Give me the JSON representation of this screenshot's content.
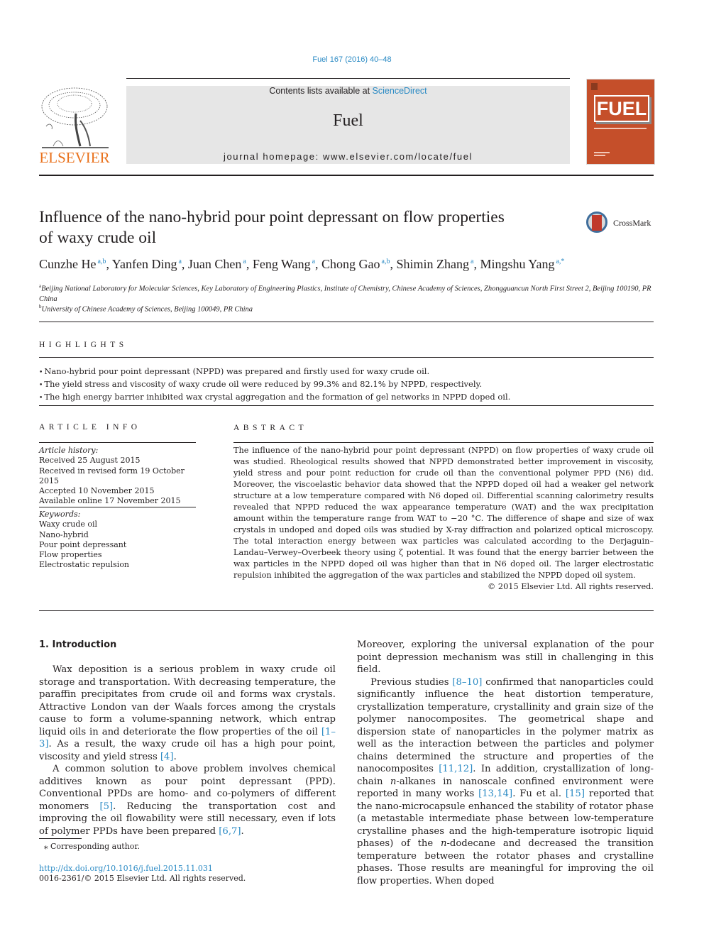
{
  "journal": {
    "citation": "Fuel 167 (2016) 40–48",
    "contents_prefix": "Contents lists available at ",
    "contents_link": "ScienceDirect",
    "name": "Fuel",
    "homepage": "journal homepage: www.elsevier.com/locate/fuel",
    "publisher_logo": "ELSEVIER",
    "cover_title": "FUEL",
    "crossmark_label": "CrossMark"
  },
  "article": {
    "title_line1": "Influence of the nano-hybrid pour point depressant on flow properties",
    "title_line2": "of waxy crude oil",
    "authors": [
      {
        "name": "Cunzhe He",
        "sup": "a,b",
        "sep": ", "
      },
      {
        "name": "Yanfen Ding",
        "sup": "a",
        "sep": ", "
      },
      {
        "name": "Juan Chen",
        "sup": "a",
        "sep": ", "
      },
      {
        "name": "Feng Wang",
        "sup": "a",
        "sep": ", "
      },
      {
        "name": "Chong Gao",
        "sup": "a,b",
        "sep": ", "
      },
      {
        "name": "Shimin Zhang",
        "sup": "a",
        "sep": ", "
      },
      {
        "name": "Mingshu Yang",
        "sup": "a,*",
        "sep": ""
      }
    ],
    "affiliations": [
      {
        "mark": "a",
        "text": "Beijing National Laboratory for Molecular Sciences, Key Laboratory of Engineering Plastics, Institute of Chemistry, Chinese Academy of Sciences, Zhongguancun North First Street 2, Beijing 100190, PR China"
      },
      {
        "mark": "b",
        "text": "University of Chinese Academy of Sciences, Beijing 100049, PR China"
      }
    ]
  },
  "highlights": {
    "heading": "HIGHLIGHTS",
    "items": [
      "Nano-hybrid pour point depressant (NPPD) was prepared and firstly used for waxy crude oil.",
      "The yield stress and viscosity of waxy crude oil were reduced by 99.3% and 82.1% by NPPD, respectively.",
      "The high energy barrier inhibited wax crystal aggregation and the formation of gel networks in NPPD doped oil."
    ]
  },
  "article_info": {
    "heading": "ARTICLE INFO",
    "history_label": "Article history:",
    "history": [
      "Received 25 August 2015",
      "Received in revised form 19 October 2015",
      "Accepted 10 November 2015",
      "Available online 17 November 2015"
    ],
    "keywords_label": "Keywords:",
    "keywords": [
      "Waxy crude oil",
      "Nano-hybrid",
      "Pour point depressant",
      "Flow properties",
      "Electrostatic repulsion"
    ]
  },
  "abstract": {
    "heading": "ABSTRACT",
    "text": "The influence of the nano-hybrid pour point depressant (NPPD) on flow properties of waxy crude oil was studied. Rheological results showed that NPPD demonstrated better improvement in viscosity, yield stress and pour point reduction for crude oil than the conventional polymer PPD (N6) did. Moreover, the viscoelastic behavior data showed that the NPPD doped oil had a weaker gel network structure at a low temperature compared with N6 doped oil. Differential scanning calorimetry results revealed that NPPD reduced the wax appearance temperature (WAT) and the wax precipitation amount within the temperature range from WAT to −20 °C. The difference of shape and size of wax crystals in undoped and doped oils was studied by X-ray diffraction and polarized optical microscopy. The total interaction energy between wax particles was calculated according to the Derjaguin–Landau–Verwey–Overbeek theory using ζ potential. It was found that the energy barrier between the wax particles in the NPPD doped oil was higher than that in N6 doped oil. The larger electrostatic repulsion inhibited the aggregation of the wax particles and stabilized the NPPD doped oil system.",
    "copyright": "© 2015 Elsevier Ltd. All rights reserved."
  },
  "introduction": {
    "heading": "1. Introduction",
    "left_p1": [
      {
        "t": "Wax deposition is a serious problem in waxy crude oil storage and transportation. With decreasing temperature, the paraffin precipitates from crude oil and forms wax crystals. Attractive London van der Waals forces among the crystals cause to form a volume-spanning network, which entrap liquid oils in and deteriorate the flow properties of the oil "
      },
      {
        "ref": "[1–3]"
      },
      {
        "t": ". As a result, the waxy crude oil has a high pour point, viscosity and yield stress "
      },
      {
        "ref": "[4]"
      },
      {
        "t": "."
      }
    ],
    "left_p2": [
      {
        "t": "A common solution to above problem involves chemical additives known as pour point depressant (PPD). Conventional PPDs are homo- and co-polymers of different monomers "
      },
      {
        "ref": "[5]"
      },
      {
        "t": ". Reducing the transportation cost and improving the oil flowability were still necessary, even if lots of polymer PPDs have been prepared "
      },
      {
        "ref": "[6,7]"
      },
      {
        "t": "."
      }
    ],
    "right_p1": [
      {
        "t": "Moreover, exploring the universal explanation of the pour point depression mechanism was still in challenging in this field."
      }
    ],
    "right_p2": [
      {
        "t": "Previous studies "
      },
      {
        "ref": "[8–10]"
      },
      {
        "t": " confirmed that nanoparticles could significantly influence the heat distortion temperature, crystallization temperature, crystallinity and grain size of the polymer nanocomposites. The geometrical shape and dispersion state of nanoparticles in the polymer matrix as well as the interaction between the particles and polymer chains determined the structure and properties of the nanocomposites "
      },
      {
        "ref": "[11,12]"
      },
      {
        "t": ". In addition, crystallization of long-chain "
      },
      {
        "i": "n"
      },
      {
        "t": "-alkanes in nanoscale confined environment were reported in many works "
      },
      {
        "ref": "[13,14]"
      },
      {
        "t": ". Fu et al. "
      },
      {
        "ref": "[15]"
      },
      {
        "t": " reported that the nano-microcapsule enhanced the stability of rotator phase (a metastable intermediate phase between low-temperature crystalline phases and the high-temperature isotropic liquid phases) of the "
      },
      {
        "i": "n"
      },
      {
        "t": "-dodecane and decreased the transition temperature between the rotator phases and crystalline phases. Those results are meaningful for improving the oil flow properties. When doped"
      }
    ]
  },
  "footer": {
    "footnote": "⁎ Corresponding author.",
    "doi": "http://dx.doi.org/10.1016/j.fuel.2015.11.031",
    "issn": "0016-2361/© 2015 Elsevier Ltd. All rights reserved."
  },
  "colors": {
    "link": "#2a8ac4",
    "elsevier_orange": "#e9711c",
    "cover_red": "#c54f2a",
    "banner_gray": "#e6e6e6"
  }
}
